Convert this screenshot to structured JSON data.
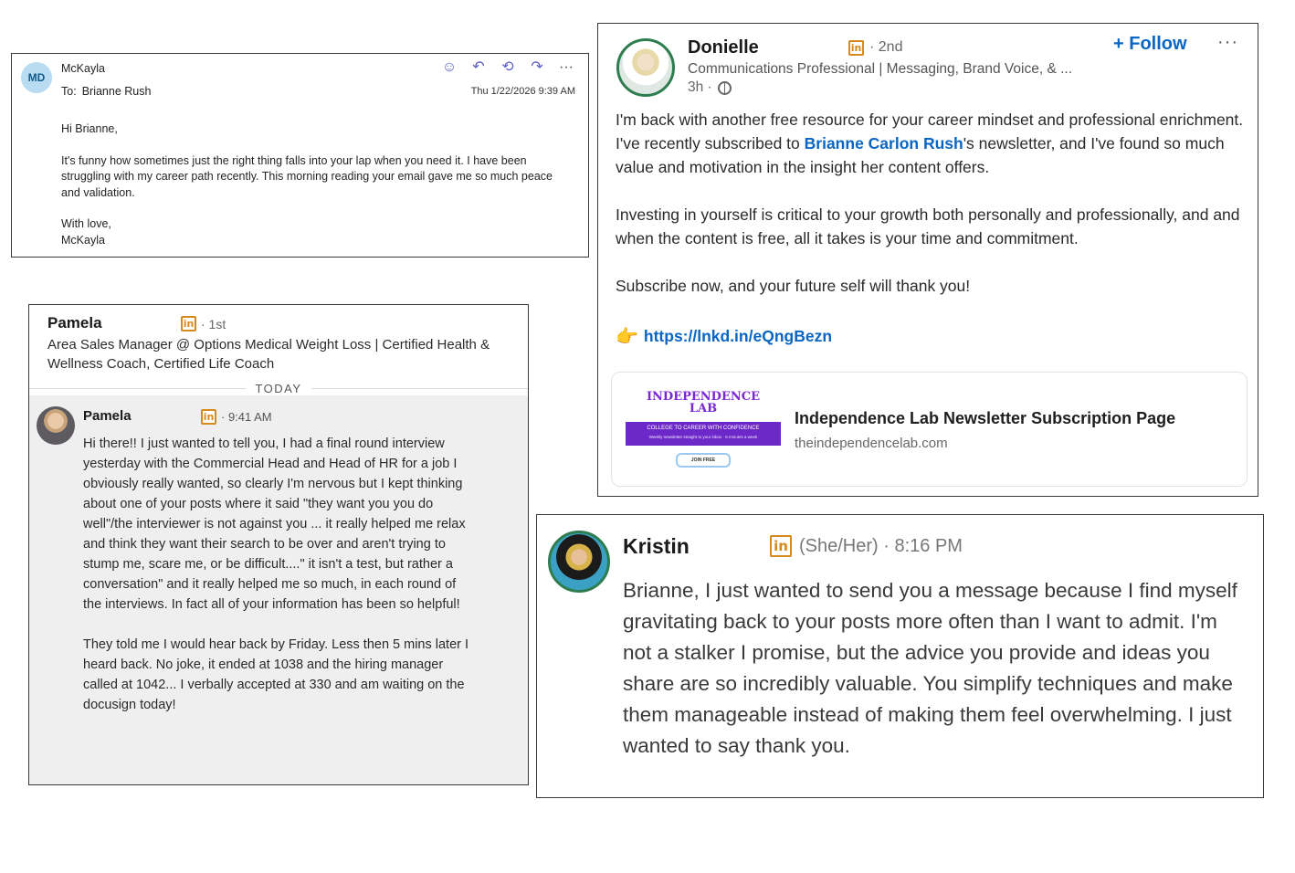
{
  "email": {
    "avatar_initials": "MD",
    "sender": "McKayla",
    "to_label": "To:",
    "to_name": "Brianne Rush",
    "date": "Thu 1/22/2026 9:39 AM",
    "greeting": "Hi Brianne,",
    "body": "It's funny how sometimes just the right thing falls into your lap when you need it. I have been struggling with my career path recently. This morning reading your email gave me so much peace and validation.",
    "closing": "With love,",
    "signature": "McKayla",
    "actions": {
      "emoji": "☺",
      "reply": "↶",
      "reply_all": "⟲",
      "forward": "↷",
      "more": "···"
    },
    "accent_color": "#5b5fc7"
  },
  "pamela": {
    "header_name": "Pamela",
    "header_connection": "· 1st",
    "header_title": "Area Sales Manager @ Options Medical Weight Loss | Certified Health & Wellness Coach, Certified Life Coach",
    "divider_label": "TODAY",
    "message_name": "Pamela",
    "message_time": "· 9:41 AM",
    "message_p1": "Hi there!! I just wanted to tell you, I had a final round interview yesterday with the Commercial Head and Head of HR for a job I obviously really wanted, so clearly I'm nervous but I kept thinking about one of your posts where it said \"they want you you do well\"/the interviewer is not against you ... it really helped me relax and think they want their search to be over and aren't trying to stump me, scare me, or be difficult....\" it isn't a test, but rather a conversation\" and it really helped me so much, in each round of the interviews. In fact all of your information has been so helpful!",
    "message_p2": "They told me I would hear back by Friday. Less then 5 mins later I heard back. No joke, it ended at 1038 and the hiring manager called at 1042... I verbally accepted at 330 and am waiting on the docusign today!",
    "scroll_icon": "↓"
  },
  "donielle": {
    "name": "Donielle",
    "connection": "· 2nd",
    "headline": "Communications Professional | Messaging, Brand Voice, & ...",
    "time": "3h ·",
    "follow_label": "+ Follow",
    "more_label": "···",
    "post_p1_before": "I'm back with another free resource for your career mindset and professional enrichment. I've recently subscribed to ",
    "post_p1_mention": "Brianne Carlon Rush",
    "post_p1_after": "'s newsletter, and I've found so much value and motivation in the insight her content offers.",
    "post_p2": "Investing in yourself is critical to your growth both personally and professionally, and and when the content is free, all it takes is your time and commitment.",
    "post_p3": "Subscribe now, and your future self will thank you!",
    "hand_icon": "👉",
    "link": "https://lnkd.in/eQngBezn",
    "preview": {
      "logo_line1": "INDEPENDENCE",
      "logo_line2": "LAB",
      "band_text": "COLLEGE TO CAREER WITH CONFIDENCE",
      "band_sub": "Weekly newsletter straight to your inbox · 5 minutes a week",
      "join_label": "JOIN FREE",
      "title": "Independence Lab Newsletter Subscription Page",
      "domain": "theindependencelab.com"
    },
    "link_color": "#0a66c2"
  },
  "kristin": {
    "name": "Kristin",
    "meta": "(She/Her) · 8:16 PM",
    "body": "Brianne, I just wanted to send you a message because I find myself gravitating back to your posts more often than I want to admit. I'm not a stalker I promise, but the advice you provide and ideas you share are so incredibly valuable. You simplify techniques and make them manageable instead of making them feel overwhelming. I just wanted to say thank you."
  },
  "linkedin_icon_glyph": "in"
}
